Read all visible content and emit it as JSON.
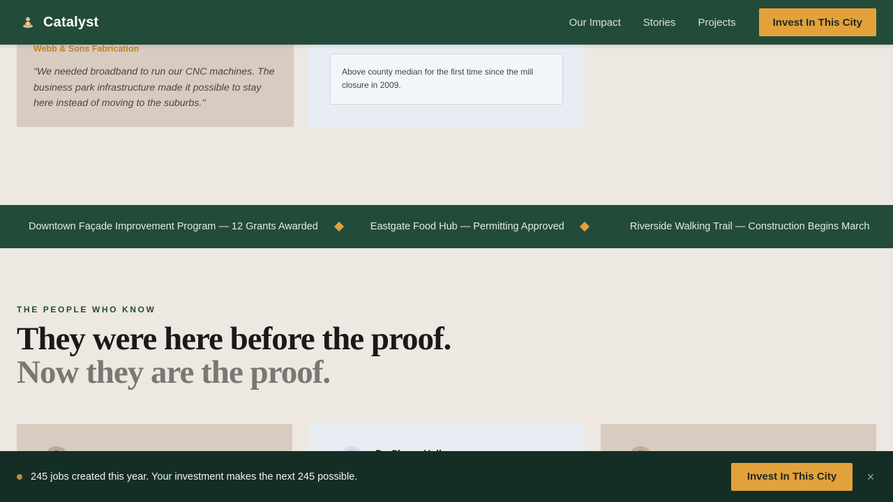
{
  "colors": {
    "brand_green": "#234b39",
    "dark_green": "#142e25",
    "accent_gold": "#e3a13b",
    "company_gold": "#c0832f",
    "page_bg": "#ede8e1",
    "card_tan": "#d8ccc1",
    "card_blue": "#e7edf3"
  },
  "header": {
    "brand_icon": "person-pin-icon",
    "brand_name": "Catalyst",
    "nav": [
      "Our Impact",
      "Stories",
      "Projects"
    ],
    "cta_label": "Invest In This City"
  },
  "story_card": {
    "company": "Webb & Sons Fabrication",
    "quote": "\"We needed broadband to run our CNC machines. The business park infrastructure made it possible to stay here instead of moving to the suburbs.\""
  },
  "stat_card": {
    "note": "Above county median for the first time since the mill closure in 2009."
  },
  "ticker": {
    "separator_icon": "diamond-icon",
    "items": [
      "Downtown Façade Improvement Program — 12 Grants Awarded",
      "Eastgate Food Hub — Permitting Approved",
      "Riverside Walking Trail — Construction Begins March"
    ]
  },
  "people": {
    "eyebrow": "THE PEOPLE WHO KNOW",
    "headline_line1": "They were here before the proof.",
    "headline_line2": "Now they are the proof.",
    "cards": [
      {
        "name": ""
      },
      {
        "name": "Dr. Shaun Hall"
      },
      {
        "name": ""
      }
    ]
  },
  "banner": {
    "message": "245 jobs created this year. Your investment makes the next 245 possible.",
    "cta_label": "Invest In This City",
    "close_icon": "close-icon",
    "close_glyph": "×"
  }
}
